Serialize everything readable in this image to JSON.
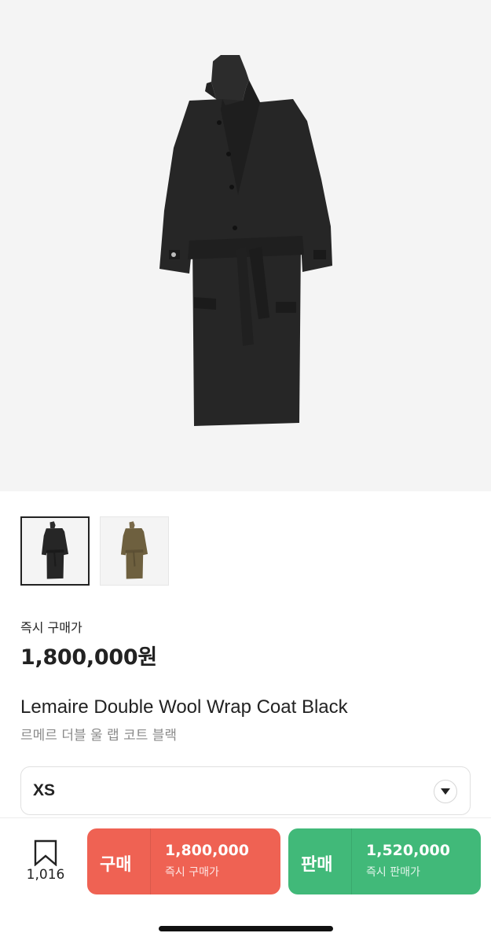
{
  "product": {
    "instant_price_label": "즉시 구매가",
    "instant_price": "1,800,000원",
    "title_en": "Lemaire Double Wool Wrap Coat Black",
    "title_ko": "르메르 더블 울 랩 코트 블랙",
    "main_image_icon": "black-wrap-coat-image",
    "thumbnails": [
      {
        "icon": "black-coat-thumbnail",
        "selected": true
      },
      {
        "icon": "olive-coat-thumbnail",
        "selected": false
      }
    ]
  },
  "size_select": {
    "value": "XS",
    "icon": "chevron-down-icon"
  },
  "bottom_bar": {
    "bookmark_icon": "bookmark-icon",
    "bookmark_count": "1,016",
    "buy": {
      "label": "구매",
      "price": "1,800,000",
      "sub": "즉시 구매가",
      "color": "#ef6253"
    },
    "sell": {
      "label": "판매",
      "price": "1,520,000",
      "sub": "즉시 판매가",
      "color": "#41b979"
    }
  }
}
